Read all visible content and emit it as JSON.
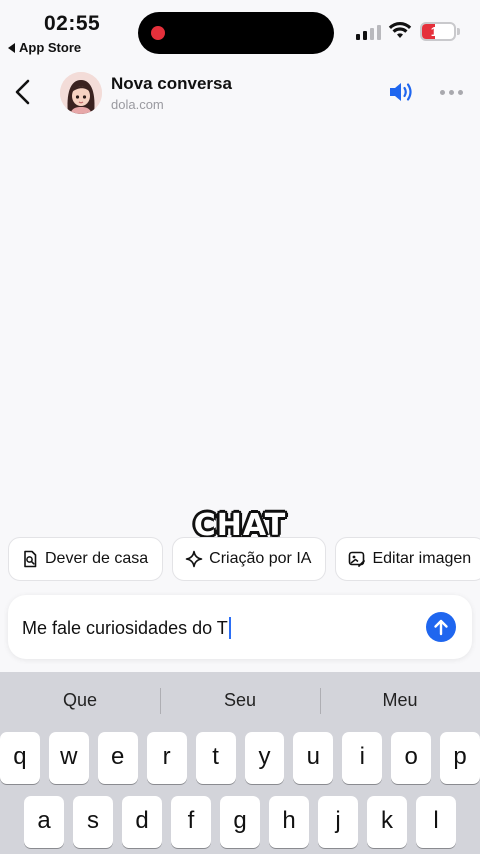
{
  "status_bar": {
    "time": "02:55",
    "back_app": "App Store",
    "battery_percent": "17",
    "battery_level": 0.17,
    "recording_color": "#e5303b"
  },
  "header": {
    "title": "Nova conversa",
    "subtitle": "dola.com",
    "accent": "#1f66ef"
  },
  "overlay_caption": "CHAT",
  "quick_actions": [
    {
      "label": "Dever de casa",
      "icon": "homework-search-icon"
    },
    {
      "label": "Criação por IA",
      "icon": "sparkle-icon"
    },
    {
      "label": "Editar imagen",
      "icon": "image-edit-icon"
    }
  ],
  "input": {
    "value": "Me fale curiosidades do T"
  },
  "keyboard": {
    "suggestions": [
      "Que",
      "Seu",
      "Meu"
    ],
    "row1": [
      "q",
      "w",
      "e",
      "r",
      "t",
      "y",
      "u",
      "i",
      "o",
      "p"
    ],
    "row2": [
      "a",
      "s",
      "d",
      "f",
      "g",
      "h",
      "j",
      "k",
      "l"
    ]
  }
}
